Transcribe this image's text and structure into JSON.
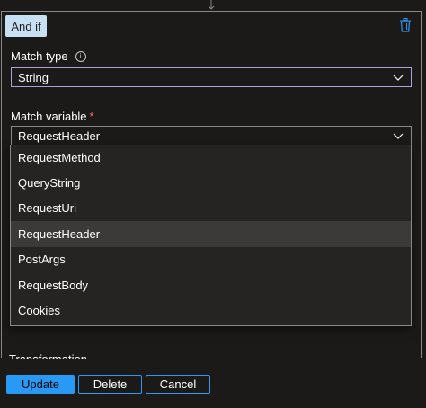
{
  "header": {
    "badge_label": "And if"
  },
  "match_type": {
    "label": "Match type",
    "info_glyph": "i",
    "value": "String"
  },
  "match_variable": {
    "label": "Match variable",
    "required_mark": "*",
    "value": "RequestHeader",
    "options": [
      {
        "label": "RequestMethod"
      },
      {
        "label": "QueryString"
      },
      {
        "label": "RequestUri"
      },
      {
        "label": "RequestHeader"
      },
      {
        "label": "PostArgs"
      },
      {
        "label": "RequestBody"
      },
      {
        "label": "Cookies"
      }
    ]
  },
  "transform": {
    "label": "Transformation"
  },
  "footer": {
    "update_label": "Update",
    "delete_label": "Delete",
    "cancel_label": "Cancel"
  },
  "colors": {
    "accent": "#2899f5",
    "badge_bg": "#c7e0f4",
    "focus_border": "#b09fd8",
    "trash_icon": "#2899f5",
    "required": "#f1707b"
  },
  "icons": [
    "arrow-down-icon",
    "trash-icon",
    "info-icon",
    "chevron-down-icon"
  ]
}
